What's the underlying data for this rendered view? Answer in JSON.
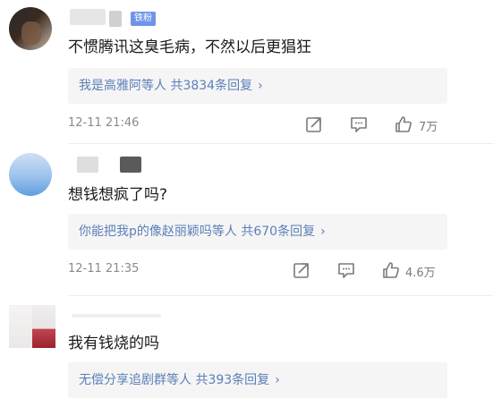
{
  "comments": [
    {
      "badge": "铁粉",
      "text": "不惯腾讯这臭毛病，不然以后更猖狂",
      "replies_prefix": "我是高雅阿等人 ",
      "replies_count": "共3834条回复",
      "time": "12-11 21:46",
      "likes": "7万"
    },
    {
      "text": "想钱想疯了吗?",
      "replies_prefix": "你能把我p的像赵丽颖吗等人 ",
      "replies_count": "共670条回复",
      "time": "12-11 21:35",
      "likes": "4.6万"
    },
    {
      "text": "我有钱烧的吗",
      "replies_prefix": "无偿分享追剧群等人 ",
      "replies_count": "共393条回复"
    }
  ],
  "icons": {
    "share": "share-icon",
    "reply": "comment-icon",
    "like": "thumb-up-icon",
    "more": "chevron-right-icon"
  },
  "colors": {
    "link": "#5b7fb7",
    "badge": "#6f95e8",
    "reply_bg": "#f5f5f5",
    "meta": "#8a8a8a"
  }
}
